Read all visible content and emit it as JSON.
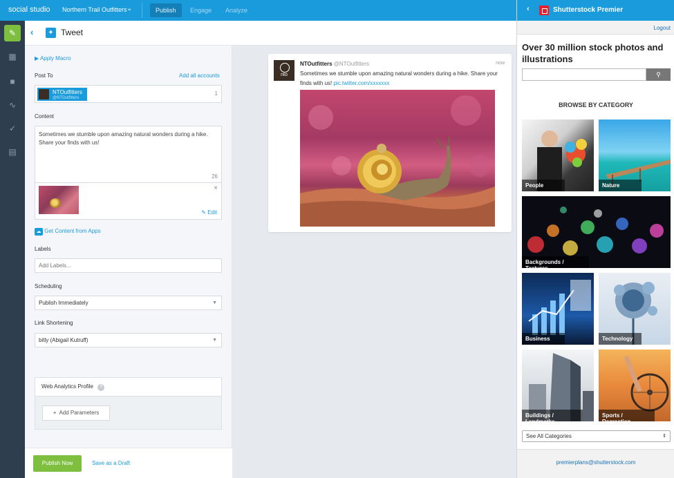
{
  "topbar": {
    "brand": "social studio",
    "org": "Northern Trail Outfitters",
    "tabs": [
      {
        "label": "Publish",
        "active": true
      },
      {
        "label": "Engage",
        "active": false
      },
      {
        "label": "Analyze",
        "active": false
      }
    ]
  },
  "sidebar": {
    "icons": [
      "compose-icon",
      "calendar-icon",
      "folder-icon",
      "activity-icon",
      "check-icon",
      "inbox-icon"
    ]
  },
  "header": {
    "title": "Tweet"
  },
  "form": {
    "apply_macro": "Apply Macro",
    "post_to_label": "Post To",
    "add_all_accounts": "Add all accounts",
    "account_name": "NTOutfitters",
    "account_handle": "@NTOutfitters",
    "account_count": "1",
    "content_label": "Content",
    "content_text": "Sometimes we stumble upon amazing natural wonders during a hike. Share your finds with us!",
    "char_count": "26",
    "edit_label": "Edit",
    "remove_glyph": "×",
    "get_content": "Get Content from Apps",
    "labels_label": "Labels",
    "labels_placeholder": "Add Labels...",
    "scheduling_label": "Scheduling",
    "scheduling_value": "Publish Immediately",
    "link_shortening_label": "Link Shortening",
    "link_shortening_value": "bitly (Abigail Kutruff)",
    "web_analytics_label": "Web Analytics Profile",
    "add_parameters": "Add Parameters",
    "publish_now": "Publish Now",
    "save_draft": "Save as a Draft"
  },
  "preview": {
    "name": "NTOutfitters",
    "handle": "@NTOutfitters",
    "time": "now",
    "text": "Sometimes we stumble upon amazing natural wonders during a hike. Share your finds with us!",
    "link": "pic.twitter.com/xxxxxxx",
    "avatar_text": "nto"
  },
  "shutterstock": {
    "title": "Shutterstock Premier",
    "logout": "Logout",
    "headline": "Over 30 million stock photos and illustrations",
    "browse": "BROWSE BY CATEGORY",
    "categories": [
      "People",
      "Nature",
      "Backgrounds / Textures",
      "Business",
      "Technology",
      "Buildings / Landmarks",
      "Sports / Recreation"
    ],
    "see_all": "See All Categories",
    "email": "premierplans@shutterstock.com"
  },
  "colors": {
    "brand_blue": "#1a9bdc",
    "sidebar_dark": "#2f3e4e",
    "accent_green": "#7fbf3f",
    "shutterstock_red": "#e5202e"
  }
}
